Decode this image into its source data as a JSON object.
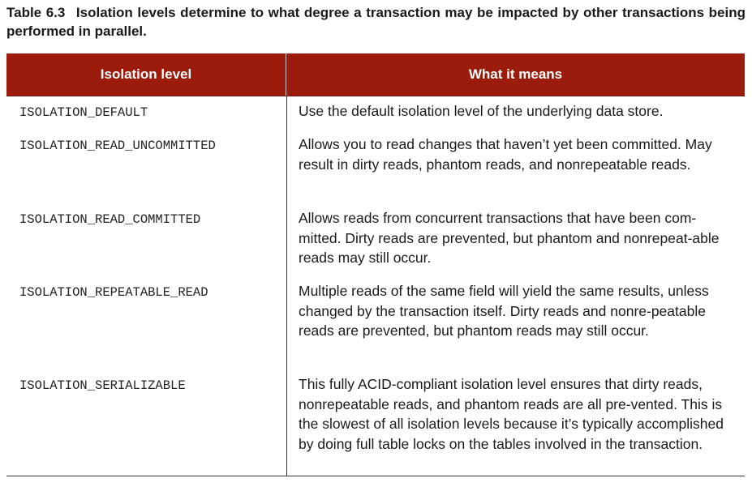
{
  "caption": {
    "number": "Table 6.3",
    "text": "Isolation levels determine to what degree a transaction may be impacted by other transactions being performed in parallel."
  },
  "table": {
    "headers": [
      "Isolation level",
      "What it means"
    ],
    "rows": [
      {
        "level": "ISOLATION_DEFAULT",
        "meaning": "Use the default isolation level of the underlying data store."
      },
      {
        "level": "ISOLATION_READ_UNCOMMITTED",
        "meaning": "Allows you to read changes that haven’t yet been committed. May result in dirty reads, phantom reads, and nonrepeatable reads."
      },
      {
        "level": "ISOLATION_READ_COMMITTED",
        "meaning": "Allows reads from concurrent transactions that have been com-mitted. Dirty reads are prevented, but phantom and nonrepeat-able reads may still occur."
      },
      {
        "level": "ISOLATION_REPEATABLE_READ",
        "meaning": "Multiple reads of the same field will yield the same results, unless changed by the transaction itself. Dirty reads and nonre-peatable reads are prevented, but phantom reads may still occur."
      },
      {
        "level": "ISOLATION_SERIALIZABLE",
        "meaning": "This fully ACID-compliant isolation level ensures that dirty reads, nonrepeatable reads, and phantom reads are all pre-vented. This is the slowest of all isolation levels because it’s typically accomplished by doing full table locks on the tables involved in the transaction."
      }
    ]
  }
}
